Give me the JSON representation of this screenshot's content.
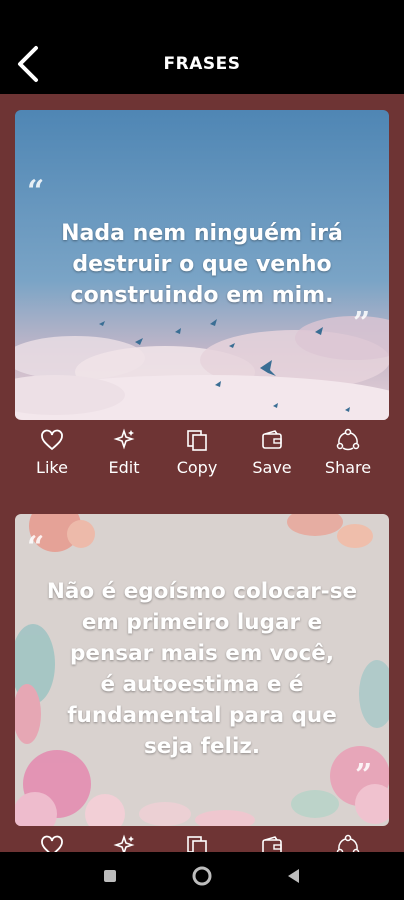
{
  "header": {
    "title": "FRASES",
    "back_icon": "chevron-left-icon"
  },
  "actions": [
    {
      "label": "Like",
      "icon": "heart-icon"
    },
    {
      "label": "Edit",
      "icon": "sparkle-icon"
    },
    {
      "label": "Copy",
      "icon": "copy-icon"
    },
    {
      "label": "Save",
      "icon": "wallet-icon"
    },
    {
      "label": "Share",
      "icon": "share-icon"
    }
  ],
  "quotes": [
    {
      "text_lines": [
        "Nada nem ninguém irá",
        "destruir o que venho",
        "construindo em mim."
      ],
      "background": "sky-with-birds"
    },
    {
      "text_lines": [
        "Não é egoísmo colocar-se",
        "em primeiro lugar e",
        "pensar mais em você,",
        "é autoestima e é",
        "fundamental para que",
        "seja feliz."
      ],
      "background": "watercolor-flowers"
    }
  ],
  "colors": {
    "bar": "#000000",
    "page_bg": "#6e3434",
    "text": "#ffffff"
  },
  "system_nav": {
    "recent": "square-icon",
    "home": "circle-icon",
    "back": "triangle-back-icon"
  }
}
